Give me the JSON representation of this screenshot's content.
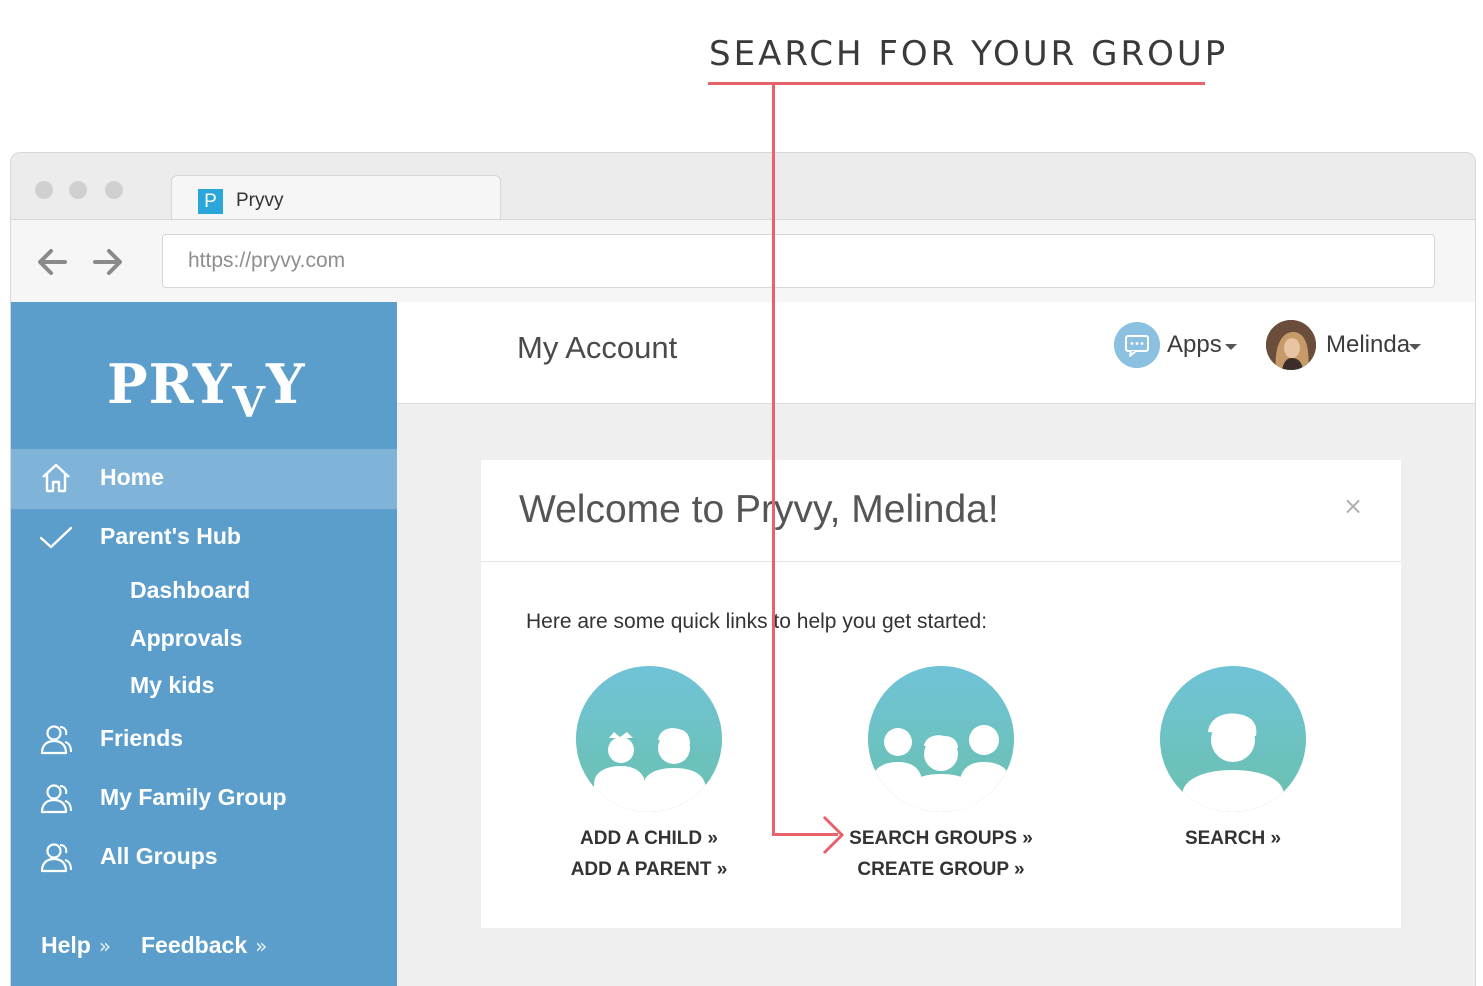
{
  "annotation": {
    "title": "SEARCH FOR YOUR GROUP",
    "accent_color": "#e8626b"
  },
  "browser": {
    "tab_favicon": "P",
    "tab_title": "Pryvy",
    "back_icon": "arrow-left-icon",
    "forward_icon": "arrow-right-icon",
    "url": "https://pryvy.com"
  },
  "sidebar": {
    "logo_main": "PRY",
    "logo_low": "V",
    "logo_tail": "Y",
    "items": [
      {
        "label": "Home",
        "icon": "home-icon",
        "active": true
      },
      {
        "label": "Parent's Hub",
        "icon": "checkmark-icon"
      },
      {
        "label": "Friends",
        "icon": "users-icon"
      },
      {
        "label": "My Family Group",
        "icon": "users-icon"
      },
      {
        "label": "All Groups",
        "icon": "users-icon"
      }
    ],
    "sub_items": [
      "Dashboard",
      "Approvals",
      "My kids"
    ],
    "footer": {
      "help": "Help",
      "feedback": "Feedback",
      "chevron": "»"
    },
    "color": "#5b9ecb"
  },
  "topbar": {
    "title": "My Account",
    "apps_label": "Apps",
    "user_label": "Melinda"
  },
  "welcome": {
    "title": "Welcome to Pryvy, Melinda!",
    "close": "×",
    "intro": "Here are some quick links to help you get started:",
    "links": [
      {
        "lines": [
          "ADD A CHILD »",
          "ADD A PARENT »"
        ],
        "icon": "parent-child-icon"
      },
      {
        "lines": [
          "SEARCH GROUPS »",
          "CREATE GROUP »"
        ],
        "icon": "group-icon"
      },
      {
        "lines": [
          "SEARCH »"
        ],
        "icon": "person-icon"
      }
    ]
  }
}
